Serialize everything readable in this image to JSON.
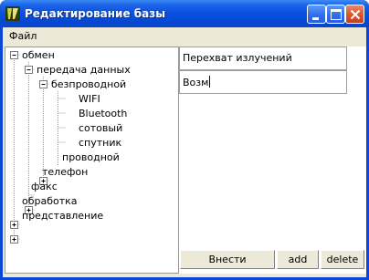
{
  "window": {
    "title": "Редактирование базы",
    "app_icon": "app-logo-icon",
    "controls": {
      "minimize": "minimize-icon",
      "maximize": "maximize-icon",
      "close": "close-icon"
    }
  },
  "menu": {
    "file": "Файл"
  },
  "tree": {
    "nodes": [
      {
        "id": "obmen",
        "label": "обмен",
        "expander": "minus"
      },
      {
        "id": "peredacha",
        "label": "передача данных",
        "expander": "minus"
      },
      {
        "id": "bezprovodnoy",
        "label": "безпроводной",
        "expander": "minus"
      },
      {
        "id": "wifi",
        "label": "WIFI",
        "expander": "none"
      },
      {
        "id": "bluetooth",
        "label": "Bluetooth",
        "expander": "none"
      },
      {
        "id": "sotovy",
        "label": "сотовый",
        "expander": "none"
      },
      {
        "id": "sputnik",
        "label": "спутник",
        "expander": "none"
      },
      {
        "id": "provodnoy",
        "label": "проводной",
        "expander": "plus"
      },
      {
        "id": "telefon",
        "label": "телефон",
        "expander": "plus"
      },
      {
        "id": "faks",
        "label": "факс",
        "expander": "none"
      },
      {
        "id": "obrabotka",
        "label": "обработка",
        "expander": "plus"
      },
      {
        "id": "predstavlenie",
        "label": "представление",
        "expander": "plus"
      }
    ]
  },
  "fields": {
    "field1_value": "Перехват излучений",
    "field2_value": "Возм"
  },
  "buttons": {
    "vnesti": "Внести",
    "add": "add",
    "delete": "delete"
  }
}
